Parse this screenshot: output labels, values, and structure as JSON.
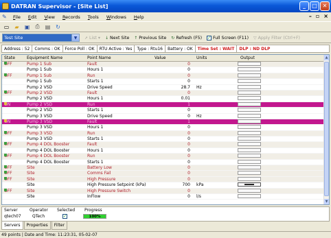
{
  "window": {
    "title": "DATRAN Supervisor - [Site List]"
  },
  "menu": [
    "File",
    "Edit",
    "View",
    "Records",
    "Tools",
    "Windows",
    "Help"
  ],
  "toolbar2": {
    "site": "Test Site",
    "list": "List",
    "next_site": "Next Site",
    "previous_site": "Previous Site",
    "refresh": "Refresh (F5)",
    "full_screen": "Full Screen (F11)",
    "apply_filter": "Apply Filter (Ctrl+F)"
  },
  "info": {
    "address": "Address : 52",
    "comms": "Comms : OK",
    "force_poll": "Force Poll : OK",
    "rtu_active": "RTU Active : Yes",
    "type": "Type : Rtu16",
    "battery": "Battery : OK",
    "time_set": "Time Set : WAIT",
    "dlp": "DLP : ND DLP"
  },
  "grid": {
    "headers": [
      "State",
      "Equipment Name",
      "Point Name",
      "Value",
      "Units",
      "Output"
    ],
    "rows": [
      {
        "state": "OFF",
        "equip": "Pump 1 Sub",
        "point": "Fault",
        "value": "0",
        "units": "",
        "style": "alarm"
      },
      {
        "state": "",
        "equip": "Pump 1 Sub",
        "point": "Hours 1",
        "value": "0",
        "units": "",
        "style": ""
      },
      {
        "state": "OFF",
        "equip": "Pump 1 Sub",
        "point": "Run",
        "value": "0",
        "units": "",
        "style": "alarm"
      },
      {
        "state": "",
        "equip": "Pump 1 Sub",
        "point": "Starts 1",
        "value": "0",
        "units": "",
        "style": ""
      },
      {
        "state": "",
        "equip": "Pump 2 VSD",
        "point": "Drive Speed",
        "value": "28.7",
        "units": "Hz",
        "style": ""
      },
      {
        "state": "OFF",
        "equip": "Pump 2 VSD",
        "point": "Fault",
        "value": "0",
        "units": "",
        "style": "alarm"
      },
      {
        "state": "",
        "equip": "Pump 2 VSD",
        "point": "Hours 1",
        "value": "0.01",
        "units": "",
        "style": ""
      },
      {
        "state": "ON",
        "equip": "Pump 2 VSD",
        "point": "Run",
        "value": "1",
        "units": "",
        "style": "pink"
      },
      {
        "state": "",
        "equip": "Pump 2 VSD",
        "point": "Starts 1",
        "value": "0",
        "units": "",
        "style": ""
      },
      {
        "state": "",
        "equip": "Pump 3 VSD",
        "point": "Drive Speed",
        "value": "0",
        "units": "Hz",
        "style": ""
      },
      {
        "state": "ON",
        "equip": "Pump 3 VSD",
        "point": "Fault",
        "value": "1",
        "units": "",
        "style": "pink"
      },
      {
        "state": "",
        "equip": "Pump 3 VSD",
        "point": "Hours 1",
        "value": "0",
        "units": "",
        "style": ""
      },
      {
        "state": "OFF",
        "equip": "Pump 3 VSD",
        "point": "Run",
        "value": "0",
        "units": "",
        "style": "alarm"
      },
      {
        "state": "",
        "equip": "Pump 3 VSD",
        "point": "Starts 1",
        "value": "0",
        "units": "",
        "style": ""
      },
      {
        "state": "OFF",
        "equip": "Pump 4 DOL Booster",
        "point": "Fault",
        "value": "0",
        "units": "",
        "style": "alarm"
      },
      {
        "state": "",
        "equip": "Pump 4 DOL Booster",
        "point": "Hours 1",
        "value": "0",
        "units": "",
        "style": ""
      },
      {
        "state": "OFF",
        "equip": "Pump 4 DOL Booster",
        "point": "Run",
        "value": "0",
        "units": "",
        "style": "alarm"
      },
      {
        "state": "",
        "equip": "Pump 4 DOL Booster",
        "point": "Starts 1",
        "value": "0",
        "units": "",
        "style": ""
      },
      {
        "state": "OFF",
        "equip": "Site",
        "point": "Battery Low",
        "value": "0",
        "units": "",
        "style": "alarm"
      },
      {
        "state": "OFF",
        "equip": "Site",
        "point": "Comms Fail",
        "value": "0",
        "units": "",
        "style": "alarm"
      },
      {
        "state": "OFF",
        "equip": "Site",
        "point": "High Pressure",
        "value": "0",
        "units": "",
        "style": "alarm"
      },
      {
        "state": "",
        "equip": "Site",
        "point": "High Pressure Setpoint (kPa)",
        "value": "700",
        "units": "kPa",
        "style": "",
        "output": "key"
      },
      {
        "state": "OFF",
        "equip": "Site",
        "point": "High Pressure Switch",
        "value": "0",
        "units": "",
        "style": "alarm"
      },
      {
        "state": "",
        "equip": "Site",
        "point": "InFlow",
        "value": "0",
        "units": "l/s",
        "style": ""
      }
    ]
  },
  "bottom": {
    "headers": [
      "Server",
      "Operator",
      "Selected",
      "Progress"
    ],
    "server": "qtech07",
    "operator": "QTech",
    "progress_text": "100%",
    "progress": 1.0
  },
  "tabs": [
    "Servers",
    "Properties",
    "Filter"
  ],
  "status": "49 points  |  Date and Time: 11:23:31, 05-02-07"
}
